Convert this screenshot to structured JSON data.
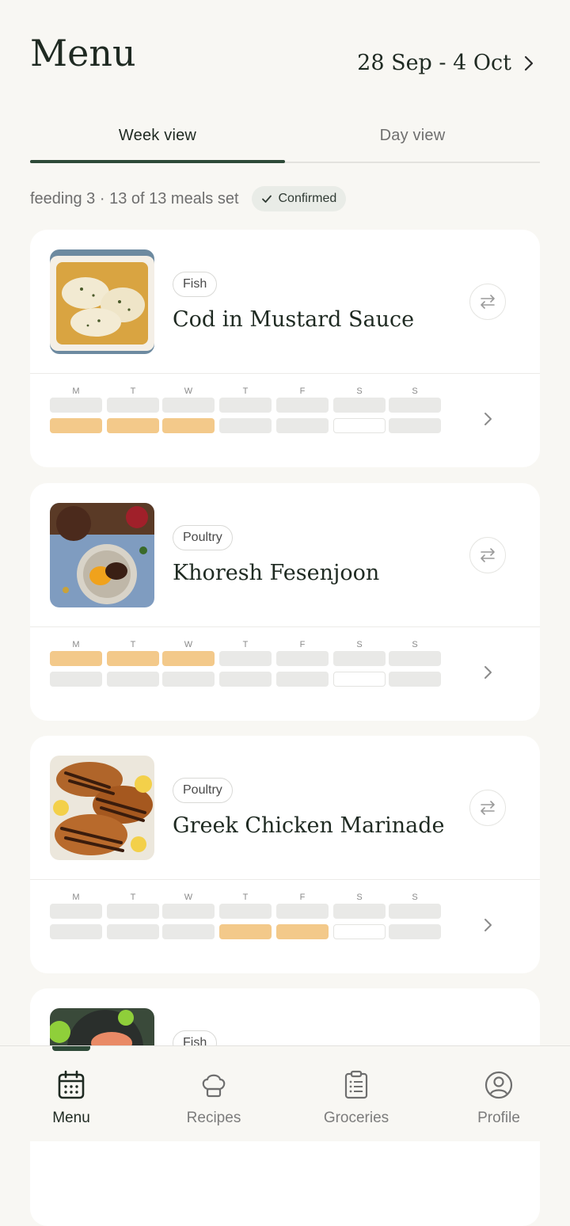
{
  "header": {
    "title": "Menu",
    "date_range": "28 Sep - 4 Oct"
  },
  "tabs": [
    {
      "label": "Week view",
      "active": true
    },
    {
      "label": "Day view",
      "active": false
    }
  ],
  "summary": {
    "text": "feeding 3 · 13 of 13 meals set",
    "status_badge": "Confirmed"
  },
  "day_labels": [
    "M",
    "T",
    "W",
    "T",
    "F",
    "S",
    "S"
  ],
  "meals": [
    {
      "category": "Fish",
      "name": "Cod in Mustard Sauce",
      "image": "cod-dish",
      "rows": [
        [
          "off",
          "off",
          "off",
          "off",
          "off",
          "off",
          "off"
        ],
        [
          "on",
          "on",
          "on",
          "off",
          "off",
          "empty",
          "off"
        ]
      ]
    },
    {
      "category": "Poultry",
      "name": "Khoresh Fesenjoon",
      "image": "stew-dish",
      "rows": [
        [
          "on",
          "on",
          "on",
          "off",
          "off",
          "off",
          "off"
        ],
        [
          "off",
          "off",
          "off",
          "off",
          "off",
          "empty",
          "off"
        ]
      ]
    },
    {
      "category": "Poultry",
      "name": "Greek Chicken Marinade",
      "image": "grilled-chicken",
      "rows": [
        [
          "off",
          "off",
          "off",
          "off",
          "off",
          "off",
          "off"
        ],
        [
          "off",
          "off",
          "off",
          "on",
          "on",
          "empty",
          "off"
        ]
      ]
    },
    {
      "category": "Fish",
      "image": "salmon-dish"
    }
  ],
  "nav": [
    {
      "label": "Menu",
      "icon": "calendar-icon",
      "active": true
    },
    {
      "label": "Recipes",
      "icon": "chef-hat-icon",
      "active": false
    },
    {
      "label": "Groceries",
      "icon": "clipboard-list-icon",
      "active": false
    },
    {
      "label": "Profile",
      "icon": "user-circle-icon",
      "active": false
    }
  ],
  "colors": {
    "accent": "#2e4a38",
    "slot_on": "#f3c98a",
    "slot_off": "#e9e9e7",
    "background": "#f8f7f3"
  }
}
